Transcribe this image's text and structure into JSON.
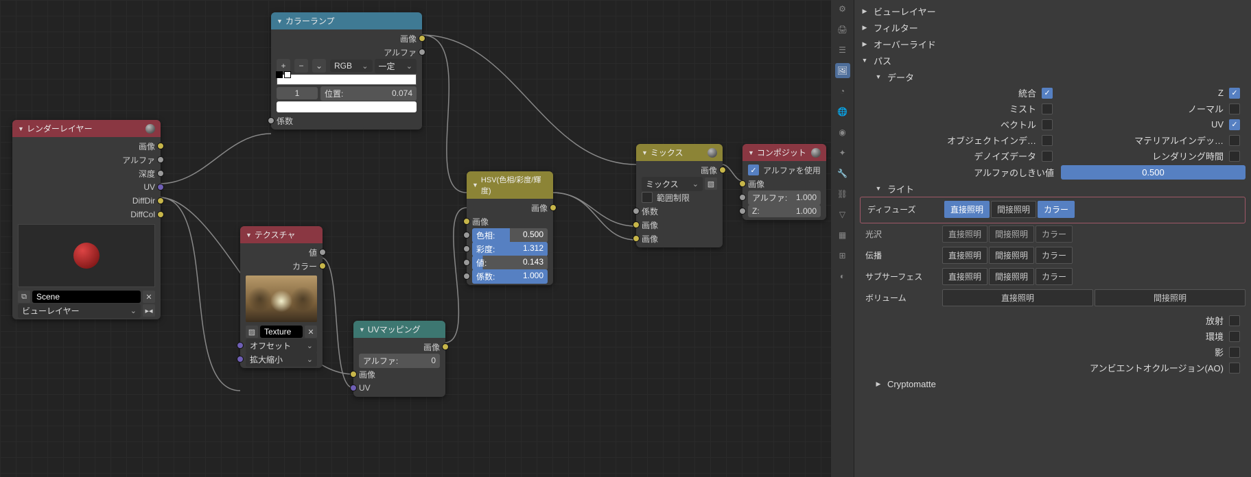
{
  "nodes": {
    "render_layers": {
      "title": "レンダーレイヤー",
      "outputs": [
        "画像",
        "アルファ",
        "深度",
        "UV",
        "DiffDir",
        "DiffCol"
      ],
      "scene_field": "Scene",
      "view_layer": "ビューレイヤー"
    },
    "color_ramp": {
      "title": "カラーランプ",
      "out_image": "画像",
      "out_alpha": "アルファ",
      "mode1": "RGB",
      "mode2": "一定",
      "pos_idx": "1",
      "pos_label": "位置:",
      "pos_val": "0.074",
      "in_fac": "係数"
    },
    "hsv": {
      "title": "HSV(色相/彩度/輝度)",
      "out_image": "画像",
      "in_image": "画像",
      "rows": [
        {
          "label": "色相:",
          "value": "0.500"
        },
        {
          "label": "彩度:",
          "value": "1.312"
        },
        {
          "label": "値:",
          "value": "0.143"
        },
        {
          "label": "係数:",
          "value": "1.000"
        }
      ]
    },
    "mix": {
      "title": "ミックス",
      "out_image": "画像",
      "blend": "ミックス",
      "clamp": "範囲制限",
      "in_fac": "係数",
      "in_image1": "画像",
      "in_image2": "画像"
    },
    "composite": {
      "title": "コンポジット",
      "use_alpha": "アルファを使用",
      "in_image": "画像",
      "alpha_label": "アルファ:",
      "alpha_val": "1.000",
      "z_label": "Z:",
      "z_val": "1.000"
    },
    "texture": {
      "title": "テクスチャ",
      "out_value": "値",
      "out_color": "カラー",
      "tex_name": "Texture",
      "offset": "オフセット",
      "scale": "拡大縮小"
    },
    "uvmap": {
      "title": "UVマッピング",
      "out_image": "画像",
      "alpha_label": "アルファ:",
      "alpha_val": "0",
      "in_image": "画像",
      "in_uv": "UV"
    }
  },
  "sidebar": {
    "sections": {
      "view_layer": "ビューレイヤー",
      "filter": "フィルター",
      "override": "オーバーライド",
      "passes": "パス",
      "data": "データ",
      "light": "ライト",
      "cryptomatte": "Cryptomatte"
    },
    "data_passes": {
      "combined": "統合",
      "z": "Z",
      "mist": "ミスト",
      "normal": "ノーマル",
      "vector": "ベクトル",
      "uv": "UV",
      "obj_index": "オブジェクトインデ…",
      "mat_index": "マテリアルインデッ…",
      "denoise": "デノイズデータ",
      "render_time": "レンダリング時間"
    },
    "alpha_threshold_label": "アルファのしきい値",
    "alpha_threshold_value": "0.500",
    "light_passes": {
      "diffuse": "ディフューズ",
      "glossy": "光沢",
      "transmission": "伝播",
      "subsurface": "サブサーフェス",
      "volume": "ボリューム",
      "direct": "直接照明",
      "indirect": "間接照明",
      "color": "カラー",
      "emission": "放射",
      "environment": "環境",
      "shadow": "影",
      "ao": "アンビエントオクルージョン(AO)"
    }
  }
}
